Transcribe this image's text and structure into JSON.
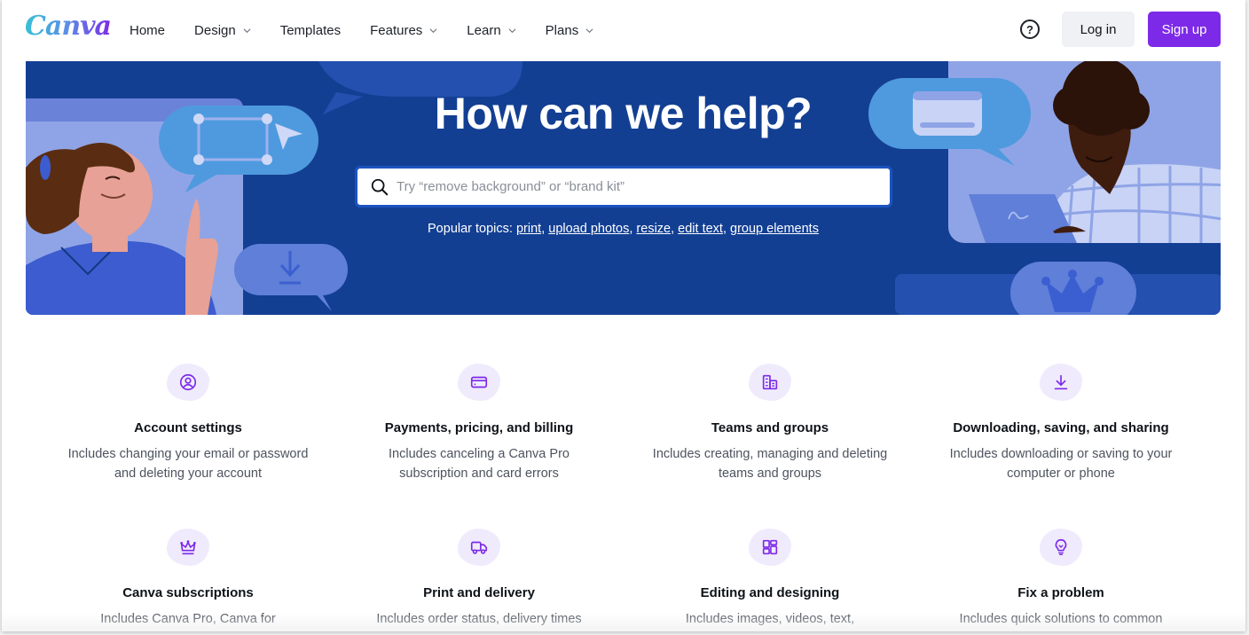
{
  "header": {
    "logo": "Canva",
    "nav": [
      {
        "label": "Home",
        "dropdown": false
      },
      {
        "label": "Design",
        "dropdown": true
      },
      {
        "label": "Templates",
        "dropdown": false
      },
      {
        "label": "Features",
        "dropdown": true
      },
      {
        "label": "Learn",
        "dropdown": true
      },
      {
        "label": "Plans",
        "dropdown": true
      }
    ],
    "help_icon": "?",
    "login_label": "Log in",
    "signup_label": "Sign up"
  },
  "hero": {
    "title": "How can we help?",
    "search_placeholder": "Try “remove background” or “brand kit”",
    "search_value": "",
    "popular_label": "Popular topics:",
    "popular_topics": [
      "print",
      "upload photos",
      "resize",
      "edit text",
      "group elements"
    ]
  },
  "topics": [
    {
      "icon": "user-circle-icon",
      "title": "Account settings",
      "desc": "Includes changing your email or password and deleting your account"
    },
    {
      "icon": "credit-card-icon",
      "title": "Payments, pricing, and billing",
      "desc": "Includes canceling a Canva Pro subscription and card errors"
    },
    {
      "icon": "building-icon",
      "title": "Teams and groups",
      "desc": "Includes creating, managing and deleting teams and groups"
    },
    {
      "icon": "download-icon",
      "title": "Downloading, saving, and sharing",
      "desc": "Includes downloading or saving to your computer or phone"
    },
    {
      "icon": "crown-icon",
      "title": "Canva subscriptions",
      "desc": "Includes Canva Pro, Canva for"
    },
    {
      "icon": "truck-icon",
      "title": "Print and delivery",
      "desc": "Includes order status, delivery times"
    },
    {
      "icon": "layout-grid-icon",
      "title": "Editing and designing",
      "desc": "Includes images, videos, text,"
    },
    {
      "icon": "lightbulb-icon",
      "title": "Fix a problem",
      "desc": "Includes quick solutions to common"
    }
  ],
  "colors": {
    "brand_purple": "#7d2ae8",
    "hero_blue": "#133f93",
    "icon_purple": "#7d2ae8",
    "icon_bg": "#efebfc"
  }
}
